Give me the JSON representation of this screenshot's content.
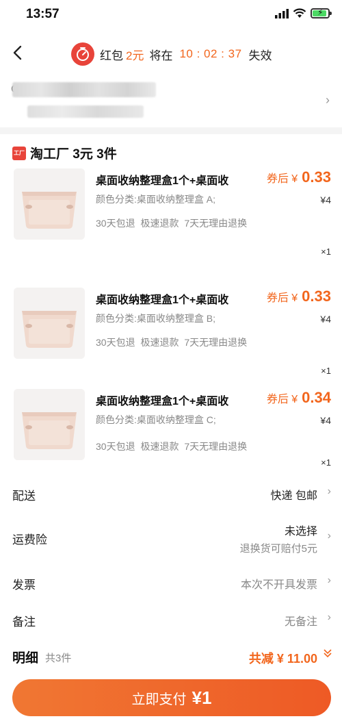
{
  "status_bar": {
    "time": "13:57"
  },
  "nav": {
    "redpacket_label": "红包",
    "redpacket_amount": "2元",
    "expire_prefix": "将在",
    "timer": "10 : 02 : 37",
    "expire_suffix": "失效"
  },
  "shop": {
    "name": "淘工厂 3元 3件",
    "icon_text": "工厂"
  },
  "products": [
    {
      "title": "桌面收纳整理盒1个+桌面收",
      "spec": "颜色分类:桌面收纳整理盒 A;",
      "service": "30天包退 极速退款 7天无理由退换",
      "price_prefix": "券后 ¥",
      "price": "0.33",
      "original": "¥4",
      "qty": "×1"
    },
    {
      "title": "桌面收纳整理盒1个+桌面收",
      "spec": "颜色分类:桌面收纳整理盒 B;",
      "service": "30天包退 极速退款 7天无理由退换",
      "price_prefix": "券后 ¥",
      "price": "0.33",
      "original": "¥4",
      "qty": "×1"
    },
    {
      "title": "桌面收纳整理盒1个+桌面收",
      "spec": "颜色分类:桌面收纳整理盒 C;",
      "service": "30天包退 极速退款 7天无理由退换",
      "price_prefix": "券后 ¥",
      "price": "0.34",
      "original": "¥4",
      "qty": "×1"
    }
  ],
  "rows": {
    "delivery": {
      "label": "配送",
      "value": "快递 包邮"
    },
    "insurance": {
      "label": "运费险",
      "value": "未选择",
      "sub": "退换货可赔付5元"
    },
    "invoice": {
      "label": "发票",
      "value": "本次不开具发票"
    },
    "remark": {
      "label": "备注",
      "value": "无备注"
    }
  },
  "summary": {
    "title": "明细",
    "count": "共3件",
    "discount": "共减 ¥ 11.00"
  },
  "pay_button": {
    "label": "立即支付",
    "amount": "¥1"
  },
  "colors": {
    "accent": "#f2661d",
    "redpacket": "#e8443a"
  }
}
